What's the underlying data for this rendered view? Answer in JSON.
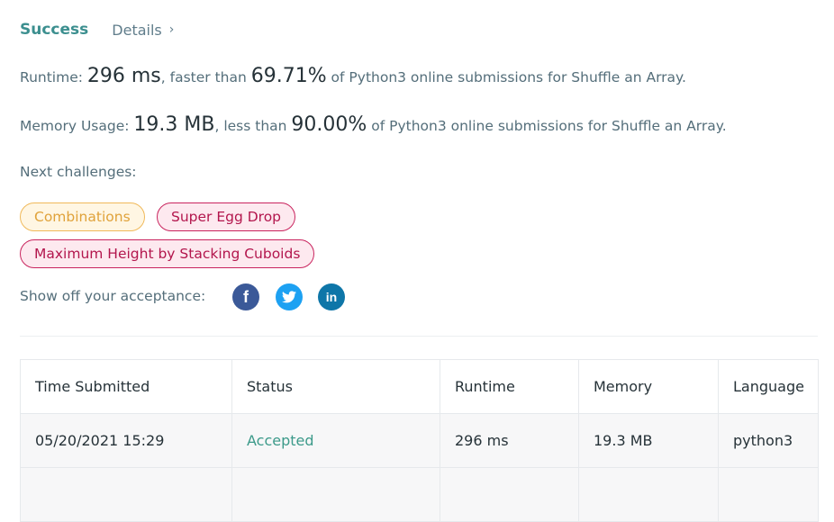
{
  "header": {
    "status": "Success",
    "details_label": "Details",
    "details_chevron": "›"
  },
  "runtime": {
    "prefix": "Runtime: ",
    "value": "296 ms",
    "mid": ", faster than ",
    "percent": "69.71%",
    "suffix": " of Python3 online submissions for Shuffle an Array."
  },
  "memory": {
    "prefix": "Memory Usage: ",
    "value": "19.3 MB",
    "mid": ", less than ",
    "percent": "90.00%",
    "suffix": " of Python3 online submissions for Shuffle an Array."
  },
  "next_challenges": {
    "label": "Next challenges:",
    "items": [
      {
        "label": "Combinations",
        "difficulty": "medium"
      },
      {
        "label": "Super Egg Drop",
        "difficulty": "hard"
      },
      {
        "label": "Maximum Height by Stacking Cuboids",
        "difficulty": "hard"
      }
    ]
  },
  "share": {
    "label": "Show off your acceptance:",
    "icons": [
      "facebook-icon",
      "twitter-icon",
      "linkedin-icon"
    ]
  },
  "table": {
    "headers": [
      "Time Submitted",
      "Status",
      "Runtime",
      "Memory",
      "Language"
    ],
    "rows": [
      [
        "05/20/2021 15:29",
        "Accepted",
        "296 ms",
        "19.3 MB",
        "python3"
      ]
    ]
  },
  "colors": {
    "success": "#3c8f8f",
    "accepted": "#3c9a8a",
    "medium_tag": "#f0b95a",
    "hard_tag": "#c9245e",
    "facebook": "#3b5998",
    "twitter": "#1da1f2",
    "linkedin": "#0e76a8"
  }
}
